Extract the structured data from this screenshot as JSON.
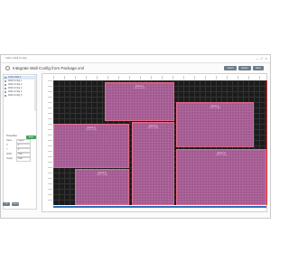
{
  "window": {
    "titlebar_text": "Video Wall Config",
    "header_title": "Integrate Wall Config from Package.xml"
  },
  "toolbar": {
    "buttons": [
      "Import",
      "Export",
      "Save",
      "Close"
    ]
  },
  "tree": {
    "items": [
      {
        "label": "Video Wall 1"
      },
      {
        "label": "Wall Config 1"
      },
      {
        "label": "Wall Config 2"
      },
      {
        "label": "Wall Config 3"
      },
      {
        "label": "Wall Config 4"
      },
      {
        "label": "Wall Config 5"
      }
    ]
  },
  "props": {
    "title": "Properties",
    "apply_label": "Apply",
    "rows": [
      {
        "label": "Name",
        "value": "Layout"
      },
      {
        "label": "X",
        "value": "0"
      },
      {
        "label": "Y",
        "value": "0"
      },
      {
        "label": "Width",
        "value": "1920"
      },
      {
        "label": "Height",
        "value": "1080"
      }
    ]
  },
  "bottom_buttons": [
    "OK",
    "Cancel"
  ],
  "panels": [
    {
      "name": "Panel 1",
      "size": "1920 x 1080"
    },
    {
      "name": "Panel 2",
      "size": "1920 x 1080"
    },
    {
      "name": "Panel 3",
      "size": "1920 x 1080"
    },
    {
      "name": "Panel 4",
      "size": "1920 x 1080"
    },
    {
      "name": "Panel 5",
      "size": "1920 x 1080"
    },
    {
      "name": "Panel 6",
      "size": "1920 x 1080"
    }
  ],
  "colors": {
    "panel_fill": "#a2578f",
    "panel_border": "#e26a8a",
    "canvas_bg": "#1c1c1c",
    "accent_blue": "#2f6fb8",
    "apply_green": "#3aa35a"
  }
}
